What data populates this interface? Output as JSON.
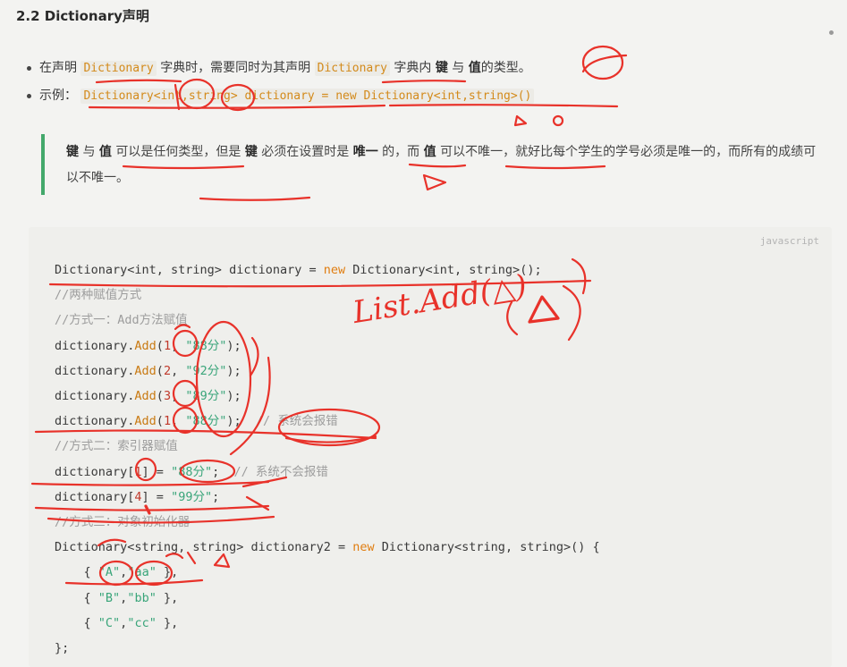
{
  "heading": "2.2 Dictionary声明",
  "bullet1": {
    "t1": "在声明",
    "code1": "Dictionary",
    "t2": "字典时，需要同时为其声明",
    "code2": "Dictionary",
    "t3": "字典内",
    "kw1": "键",
    "t4": "与",
    "kw2": "值",
    "t5": "的类型。"
  },
  "bullet2": {
    "label": "示例：",
    "code": "Dictionary<int,string> dictionary = new Dictionary<int,string>()"
  },
  "quote": {
    "k1": "键",
    "t1": "与",
    "k2": "值",
    "t2": "可以是任何类型，但是",
    "k3": "键",
    "t3": "必须在设置时是",
    "k4": "唯一",
    "t4": "的，而",
    "k5": "值",
    "t5": "可以不唯一，就好比每个学生的学号必须是唯一的，而所有的成绩可以不唯一。"
  },
  "code_block": {
    "language": "javascript",
    "lines": [
      {
        "a": "Dictionary<int, string> dictionary = ",
        "kw": "new",
        "b": " Dictionary<int, string>();"
      },
      {
        "comment": "//两种赋值方式"
      },
      {
        "comment": "//方式一：Add方法赋值"
      },
      {
        "a": "dictionary.",
        "fn": "Add",
        "b": "(",
        "num": "1",
        "c": ", ",
        "str": "\"88分\"",
        "d": ");"
      },
      {
        "a": "dictionary.",
        "fn": "Add",
        "b": "(",
        "num": "2",
        "c": ", ",
        "str": "\"92分\"",
        "d": ");"
      },
      {
        "a": "dictionary.",
        "fn": "Add",
        "b": "(",
        "num": "3",
        "c": ", ",
        "str": "\"89分\"",
        "d": ");"
      },
      {
        "a": "dictionary.",
        "fn": "Add",
        "b": "(",
        "num": "1",
        "c": ", ",
        "str": "\"88分\"",
        "d": ");  ",
        "comment": "// 系统会报错"
      },
      {
        "comment": "//方式二：索引器赋值"
      },
      {
        "a": "dictionary[",
        "num": "1",
        "b": "] = ",
        "str": "\"88分\"",
        "c": ";  ",
        "comment": "// 系统不会报错"
      },
      {
        "a": "dictionary[",
        "num": "4",
        "b": "] = ",
        "str": "\"99分\"",
        "c": ";"
      },
      {
        "comment": "//方式三：对象初始化器"
      },
      {
        "a": "Dictionary<string, string> dictionary2 = ",
        "kw": "new",
        "b": " Dictionary<string, string>() {"
      },
      {
        "a": "    { ",
        "str": "\"A\"",
        "b": ",",
        "str2": "\"aa\"",
        "c": " },"
      },
      {
        "a": "    { ",
        "str": "\"B\"",
        "b": ",",
        "str2": "\"bb\"",
        "c": " },"
      },
      {
        "a": "    { ",
        "str": "\"C\"",
        "b": ",",
        "str2": "\"cc\"",
        "c": " },"
      },
      {
        "a": "};"
      }
    ]
  },
  "handwriting": "List.Add(△)",
  "ink_color": "#e8322a"
}
